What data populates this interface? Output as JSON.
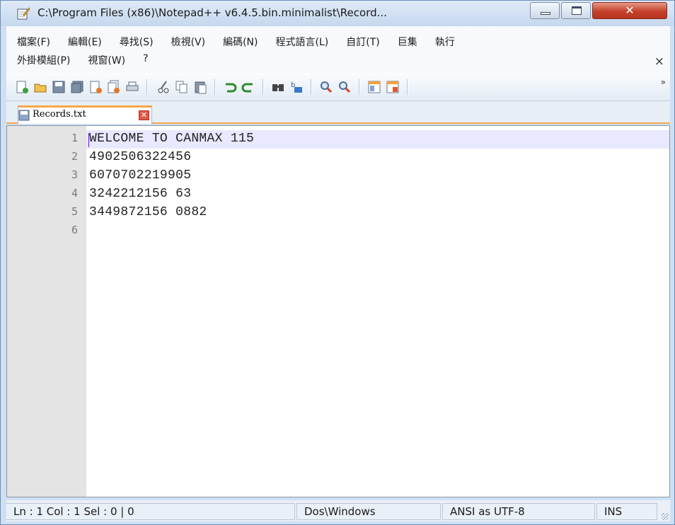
{
  "window": {
    "title": "C:\\Program Files (x86)\\Notepad++ v6.4.5.bin.minimalist\\Record..."
  },
  "menu": {
    "row1": [
      "檔案(F)",
      "編輯(E)",
      "尋找(S)",
      "檢視(V)",
      "編碼(N)",
      "程式語言(L)",
      "自訂(T)",
      "巨集",
      "執行"
    ],
    "row2": [
      "外掛模組(P)",
      "視窗(W)",
      "?"
    ],
    "close_glyph": "×"
  },
  "toolbar": {
    "icons": [
      "new-file-icon",
      "open-file-icon",
      "save-icon",
      "save-all-icon",
      "close-icon",
      "close-all-icon",
      "print-icon",
      "cut-icon",
      "copy-icon",
      "paste-icon",
      "undo-icon",
      "redo-icon",
      "find-icon",
      "replace-icon",
      "zoom-in-icon",
      "zoom-out-icon",
      "sync-v-icon",
      "sync-h-icon"
    ],
    "overflow": "»"
  },
  "tab": {
    "label": "Records.txt",
    "close_glyph": "✕"
  },
  "editor": {
    "line_numbers": [
      "1",
      "2",
      "3",
      "4",
      "5",
      "6"
    ],
    "lines": [
      "WELCOME TO CANMAX 115",
      "4902506322456",
      "6070702219905",
      "3242212156 63",
      "3449872156 0882",
      ""
    ]
  },
  "status": {
    "position": "Ln : 1   Col : 1   Sel : 0 | 0",
    "eol": "Dos\\Windows",
    "encoding": "ANSI as UTF-8",
    "mode": "INS"
  },
  "colors": {
    "current_line": "#e8e8ff",
    "tab_accent": "#f7a64b",
    "close_button": "#c4402b"
  }
}
